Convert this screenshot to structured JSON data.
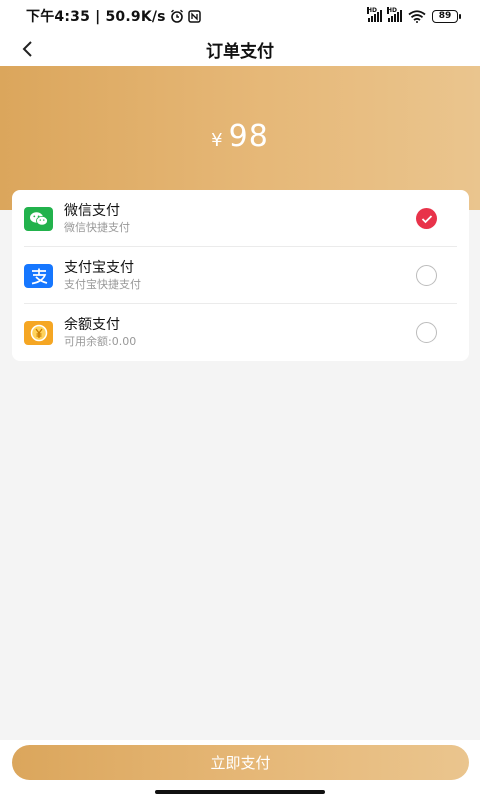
{
  "status_bar": {
    "time_text": "下午4:35 | 50.9K/s",
    "battery": "89",
    "signal_labels": [
      "HD",
      "HD"
    ]
  },
  "nav": {
    "title": "订单支付"
  },
  "order": {
    "currency": "¥",
    "amount": "98"
  },
  "payment_methods": [
    {
      "name": "微信支付",
      "desc": "微信快捷支付",
      "icon": "wechat-pay-icon",
      "color": "#22b24c",
      "selected": true
    },
    {
      "name": "支付宝支付",
      "desc": "支付宝快捷支付",
      "icon": "alipay-icon",
      "color": "#1677ff",
      "selected": false
    },
    {
      "name": "余额支付",
      "desc": "可用余额:0.00",
      "icon": "balance-icon",
      "color": "#f5a623",
      "selected": false
    }
  ],
  "action": {
    "pay_label": "立即支付"
  },
  "theme": {
    "accent_gradient": [
      "#dba65c",
      "#eac58e"
    ],
    "check_color": "#e8334a"
  }
}
